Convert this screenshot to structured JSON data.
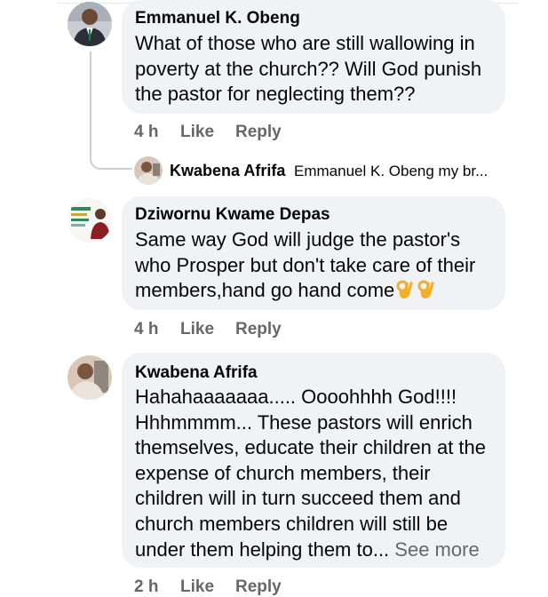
{
  "comments": [
    {
      "author": "Emmanuel K. Obeng",
      "lines": [
        "What of those who are still wallowing in",
        "poverty at the church?? Will God punish",
        "the pastor for neglecting them??"
      ],
      "time": "4 h",
      "like": "Like",
      "reply": "Reply",
      "avatar_icon": "avatar-photo-man-suit"
    },
    {
      "author": "Dziwornu Kwame Depas",
      "lines": [
        "Same way God will judge the pastor's",
        "who Prosper but don't take care of their",
        "members,hand go hand come"
      ],
      "emoji": [
        "ok-hand-emoji",
        "ok-hand-emoji"
      ],
      "time": "4 h",
      "like": "Like",
      "reply": "Reply",
      "avatar_icon": "avatar-campaign-poster"
    },
    {
      "author": "Kwabena Afrifa",
      "lines": [
        "Hahahaaaaaaa..... Oooohhhh God!!!!",
        "Hhhmmmm... These pastors will enrich",
        "themselves, educate their children at the",
        "expense of church members, their",
        "children will in turn succeed them and",
        "church members children will still be",
        "under them helping them to..."
      ],
      "see_more": "See more",
      "time": "2 h",
      "like": "Like",
      "reply": "Reply",
      "avatar_icon": "avatar-photo-person"
    }
  ],
  "reply_preview": {
    "author": "Kwabena Afrifa",
    "snippet": "Emmanuel K. Obeng my br..."
  },
  "colors": {
    "bubble": "#f0f2f5",
    "secondary_text": "#65676b",
    "primary_text": "#050505",
    "thread_line": "#ccd0d5"
  }
}
